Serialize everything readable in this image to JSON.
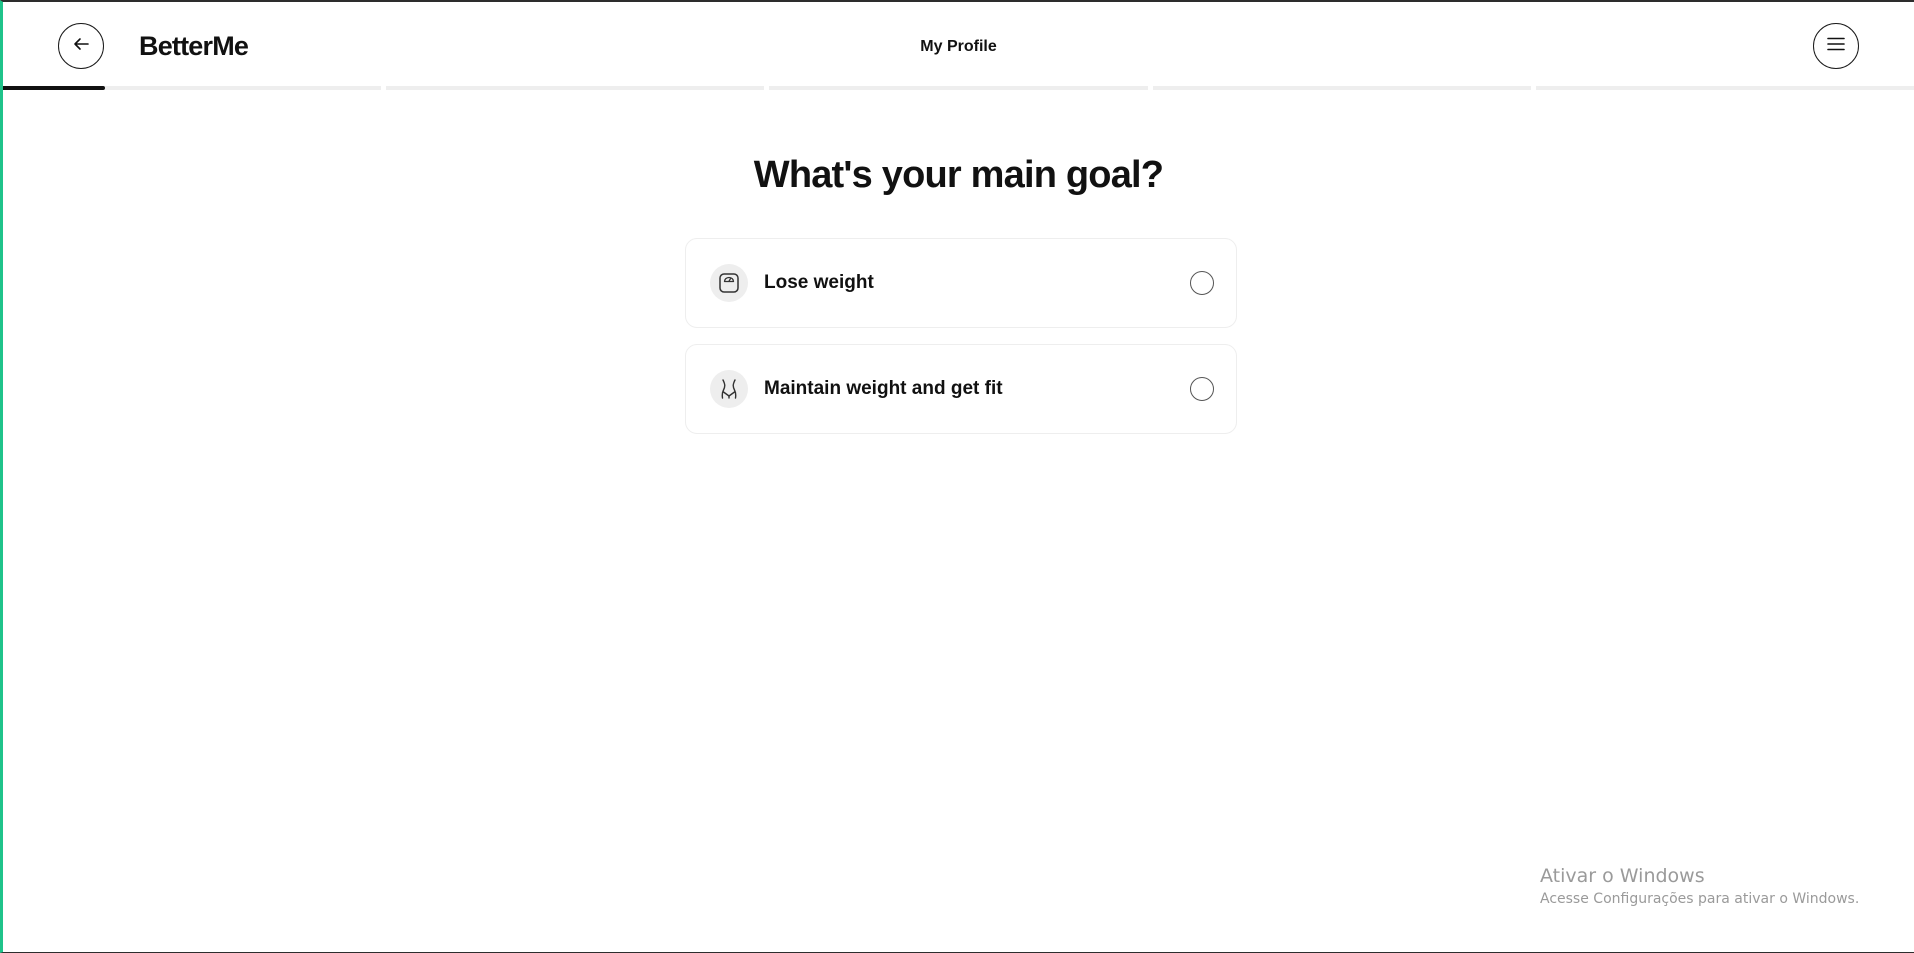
{
  "header": {
    "logo": "BetterMe",
    "title": "My Profile",
    "back_icon": "arrow-left-icon",
    "menu_icon": "hamburger-menu-icon"
  },
  "progress": {
    "segments": 5,
    "active_segment": 1,
    "active_fill_fraction": 0.27
  },
  "question": {
    "text": "What's your main goal?"
  },
  "options": [
    {
      "label": "Lose weight",
      "icon": "scale-icon",
      "selected": false
    },
    {
      "label": "Maintain weight and get fit",
      "icon": "waist-icon",
      "selected": false
    }
  ],
  "watermark": {
    "title": "Ativar o Windows",
    "subtitle": "Acesse Configurações para ativar o Windows."
  },
  "colors": {
    "text": "#111111",
    "card_border": "#eeeeee",
    "icon_bg": "#eeeeee",
    "progress_track": "#eeeeee",
    "progress_fill": "#111111",
    "window_accent": "#1fc38a"
  }
}
